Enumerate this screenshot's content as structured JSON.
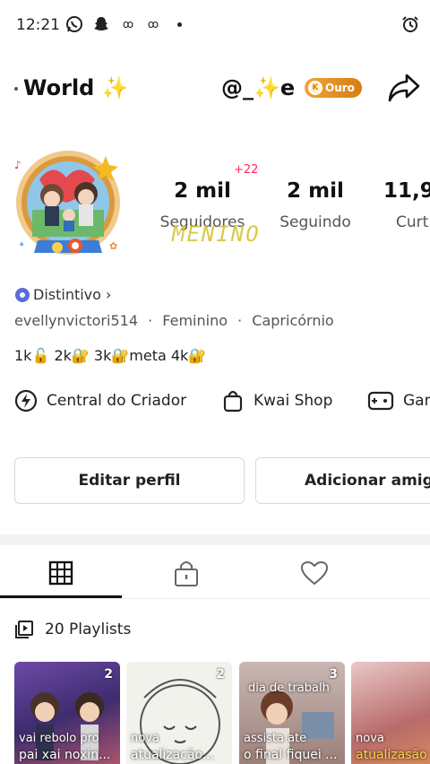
{
  "status_bar": {
    "time": "12:21"
  },
  "header": {
    "name_prefix": "World",
    "name_sparkle": "✨",
    "handle_prefix": "@_",
    "handle_sparkle": "✨",
    "handle_suffix": "e",
    "badge_label": "Ouro"
  },
  "stats": [
    {
      "value": "2 mil",
      "label": "Seguidores"
    },
    {
      "value": "2 mil",
      "label": "Seguindo"
    },
    {
      "value": "11,9",
      "label": "Curt"
    }
  ],
  "followers_delta": "+22",
  "overlay_text": "MENINO",
  "badge_link": "Distintivo ›",
  "info": {
    "username": "evellynvictori514",
    "gender": "Feminino",
    "sign": "Capricórnio"
  },
  "goals_text": "1k🔓 2k🔐 3k🔐meta 4k🔐",
  "shortcuts": [
    {
      "label": "Central do Criador",
      "icon": "lightning-icon"
    },
    {
      "label": "Kwai Shop",
      "icon": "shopping-bag-icon"
    },
    {
      "label": "Gam",
      "icon": "gamepad-icon"
    }
  ],
  "buttons": {
    "edit": "Editar perfil",
    "add": "Adicionar amigos"
  },
  "tabs": [
    {
      "name": "grid",
      "icon": "grid-icon"
    },
    {
      "name": "private",
      "icon": "lock-icon"
    },
    {
      "name": "liked",
      "icon": "heart-icon"
    }
  ],
  "playlists_label": "20 Playlists",
  "playlist_thumbs": [
    {
      "count": "2",
      "top": "",
      "line1": "vai rebolo pro",
      "line2": "pai xai noxin..."
    },
    {
      "count": "2",
      "top": "",
      "line1": "nova",
      "line2": "atualizacão..."
    },
    {
      "count": "3",
      "top": "dia de trabalh",
      "line1": "assista ate",
      "line2": "o final fiquei ..."
    },
    {
      "count": "",
      "top": "",
      "line1": "nova",
      "line2": "atualizasão"
    }
  ],
  "colors": {
    "accent_red": "#ff2d55",
    "gold": "#e08a20",
    "badge_blue": "#5b6bd8"
  }
}
